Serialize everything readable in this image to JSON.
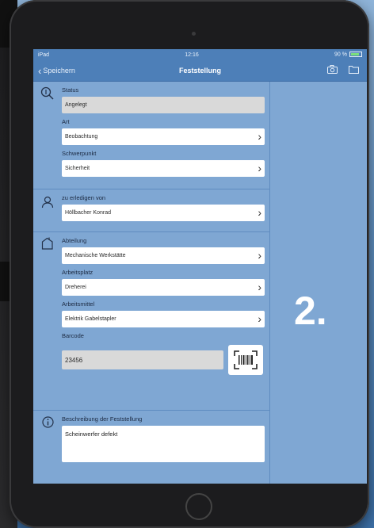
{
  "status_bar": {
    "carrier": "iPad ",
    "time": "12:16",
    "battery": "90 %"
  },
  "navbar": {
    "back_label": "Speichern",
    "title": "Feststellung",
    "camera_icon": "camera-icon",
    "folder_icon": "folder-icon"
  },
  "form": {
    "status": {
      "label": "Status",
      "value": "Angelegt"
    },
    "art": {
      "label": "Art",
      "value": "Beobachtung"
    },
    "schwerpunkt": {
      "label": "Schwerpunkt",
      "value": "Sicherheit"
    },
    "zuErledigen": {
      "label": "zu erledigen von",
      "value": "Höllbacher Konrad"
    },
    "abteilung": {
      "label": "Abteilung",
      "value": "Mechanische Werkstätte"
    },
    "arbeitsplatz": {
      "label": "Arbeitsplatz",
      "value": "Dreherei"
    },
    "arbeitsmittel": {
      "label": "Arbeitsmittel",
      "value": "Elektrik Gabelstapler"
    },
    "barcode": {
      "label": "Barcode",
      "value": "23456"
    },
    "beschreibung": {
      "label": "Beschreibung der Feststellung",
      "value": "Scheinwerfer defekt"
    }
  },
  "overlay_number": "2."
}
